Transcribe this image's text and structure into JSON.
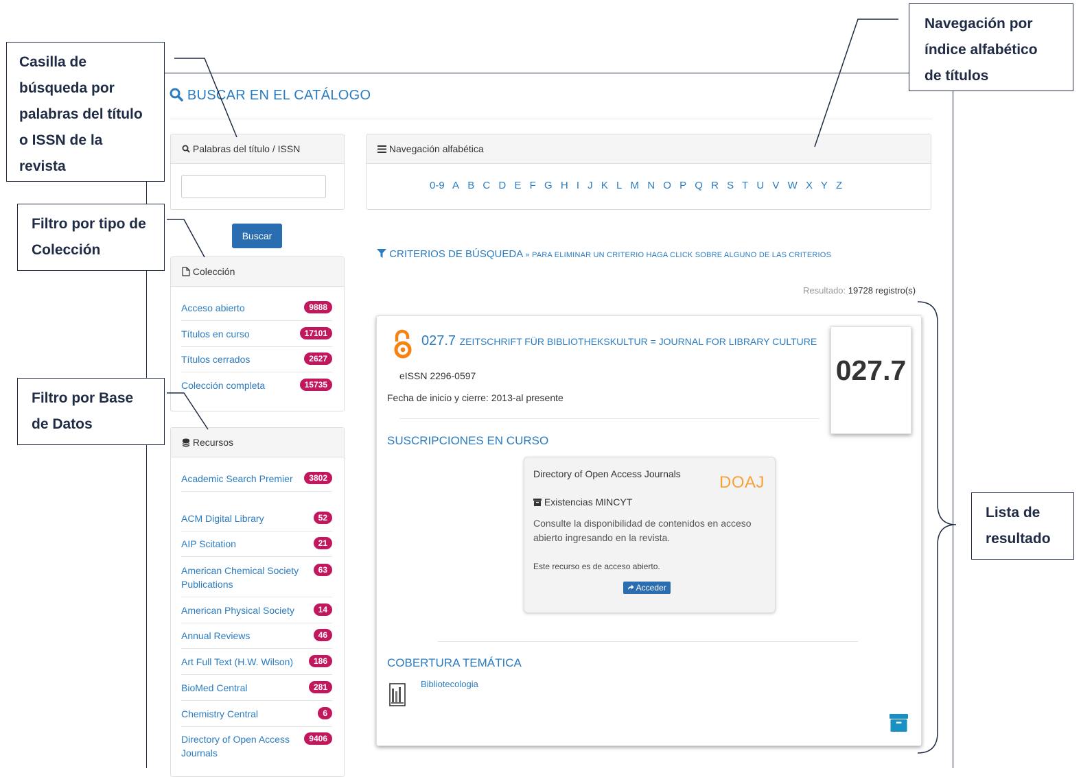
{
  "page": {
    "title": "BUSCAR EN EL CATÁLOGO"
  },
  "search_panel": {
    "heading": "Palabras del título / ISSN",
    "input_value": "",
    "button": "Buscar"
  },
  "collection_panel": {
    "heading": "Colección",
    "items": [
      {
        "label": "Acceso abierto",
        "count": "9888"
      },
      {
        "label": "Títulos en curso",
        "count": "17101"
      },
      {
        "label": "Títulos cerrados",
        "count": "2627"
      },
      {
        "label": "Colección completa",
        "count": "15735"
      }
    ]
  },
  "resources_panel": {
    "heading": "Recursos",
    "items": [
      {
        "label": "Academic Search Premier",
        "count": "3802"
      },
      {
        "label": "ACM Digital Library",
        "count": "52"
      },
      {
        "label": "AIP Scitation",
        "count": "21"
      },
      {
        "label": "American Chemical Society Publications",
        "count": "63"
      },
      {
        "label": "American Physical Society",
        "count": "14"
      },
      {
        "label": "Annual Reviews",
        "count": "46"
      },
      {
        "label": "Art Full Text (H.W. Wilson)",
        "count": "186"
      },
      {
        "label": "BioMed Central",
        "count": "281"
      },
      {
        "label": "Chemistry Central",
        "count": "6"
      },
      {
        "label": "Directory of Open Access Journals",
        "count": "9406"
      }
    ]
  },
  "alpha_nav": {
    "heading": "Navegación alfabética",
    "letters": [
      "0-9",
      "A",
      "B",
      "C",
      "D",
      "E",
      "F",
      "G",
      "H",
      "I",
      "J",
      "K",
      "L",
      "M",
      "N",
      "O",
      "P",
      "Q",
      "R",
      "S",
      "T",
      "U",
      "V",
      "W",
      "X",
      "Y",
      "Z"
    ]
  },
  "criteria": {
    "title": "CRITERIOS DE BÚSQUEDA",
    "hint": "» PARA ELIMINAR UN CRITERIO HAGA CLICK SOBRE ALGUNO DE LAS CRITERIOS"
  },
  "result": {
    "label": "Resultado:",
    "count": "19728 registro(s)"
  },
  "journal": {
    "name": "027.7",
    "subtitle": "ZEITSCHRIFT FÜR BIBLIOTHEKSKULTUR = JOURNAL FOR LIBRARY CULTURE",
    "issn": "eISSN 2296-0597",
    "dates": "Fecha de inicio y cierre: 2013-al presente",
    "cover_text": "027.7",
    "subscriptions_title": "SUSCRIPCIONES EN CURSO",
    "provider": {
      "name": "Directory of Open Access Journals",
      "logo": "DOAJ",
      "holdings": "Existencias MINCYT",
      "description": "Consulte la disponibilidad de contenidos en acceso abierto ingresando en la revista.",
      "note": "Este recurso es de acceso abierto.",
      "button": "Acceder"
    },
    "coverage_title": "COBERTURA TEMÁTICA",
    "subject": "Bibliotecologia"
  },
  "callouts": {
    "search": "Casilla de búsqueda por palabras del título o ISSN de la revista",
    "alpha": "Navegación por índice alfabético de títulos",
    "collection": "Filtro por tipo de Colección",
    "database": "Filtro por Base de Datos",
    "results": "Lista de resultado"
  },
  "colors": {
    "link": "#2a7bbf",
    "badge": "#c0175d",
    "primary_button": "#2a6db0",
    "callout_border": "#1f2a44",
    "open_access_icon": "#f68212",
    "doaj_logo": "#f7a239"
  }
}
